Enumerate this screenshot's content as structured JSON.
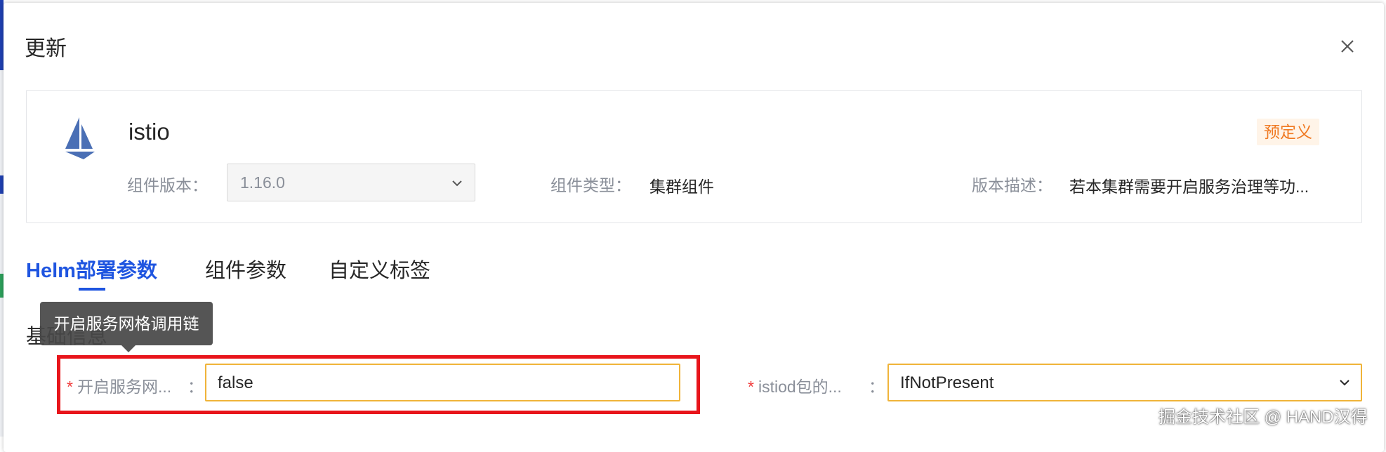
{
  "dialog": {
    "title": "更新"
  },
  "component": {
    "name": "istio",
    "badge": "预定义",
    "version_label": "组件版本：",
    "version_value": "1.16.0",
    "type_label": "组件类型：",
    "type_value": "集群组件",
    "desc_label": "版本描述：",
    "desc_value": "若本集群需要开启服务治理等功..."
  },
  "tabs": [
    {
      "label": "Helm部署参数",
      "active": true
    },
    {
      "label": "组件参数",
      "active": false
    },
    {
      "label": "自定义标签",
      "active": false
    }
  ],
  "section": {
    "title": "基础信息"
  },
  "tooltip": {
    "text": "开启服务网格调用链"
  },
  "form": {
    "field1": {
      "label": "开启服务网...",
      "required": "*",
      "colon": "：",
      "value": "false"
    },
    "field2": {
      "label": "istiod包的...",
      "required": "*",
      "colon": "：",
      "value": "IfNotPresent"
    }
  },
  "watermark": "掘金技术社区 @ HAND汉得",
  "colors": {
    "accent": "#1f55e0",
    "badge": "#f07a23",
    "highlight": "#e8151b",
    "focus": "#f0b43a"
  }
}
